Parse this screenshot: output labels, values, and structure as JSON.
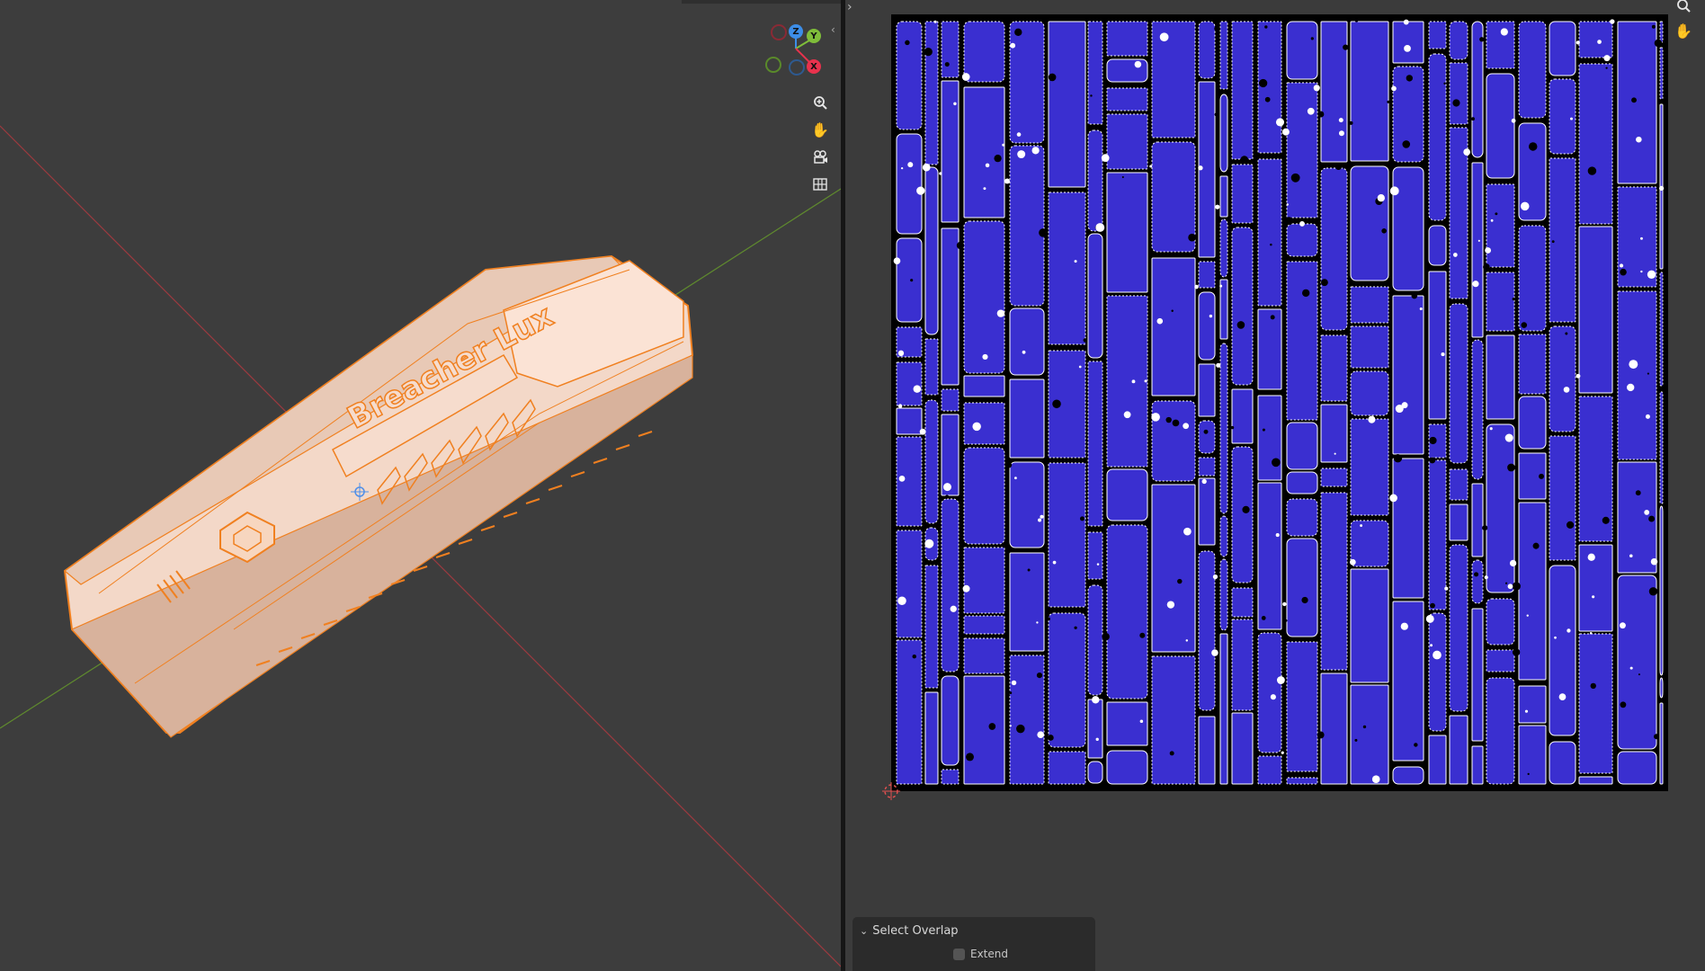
{
  "viewport": {
    "object_label": "Breacher Lux",
    "gizmo": {
      "z_label": "Z",
      "y_label": "Y",
      "x_label": "X",
      "colors": {
        "x": "#e8324d",
        "y": "#7fbd3a",
        "z": "#3d8ee8"
      }
    },
    "tools": [
      "zoom-icon",
      "pan-hand-icon",
      "camera-icon",
      "grid-icon"
    ]
  },
  "uv_editor": {
    "tools": [
      "zoom-icon",
      "pan-hand-icon"
    ],
    "island_color": "#3a2fd0",
    "edge_color": "#ffffff"
  },
  "operator_panel": {
    "title": "Select Overlap",
    "extend_label": "Extend",
    "extend_checked": false
  },
  "colors": {
    "selection_orange": "#f08020",
    "mesh_fill": "#f2d6c6",
    "axis_x": "#b5323c",
    "axis_y": "#6b9c2d"
  }
}
